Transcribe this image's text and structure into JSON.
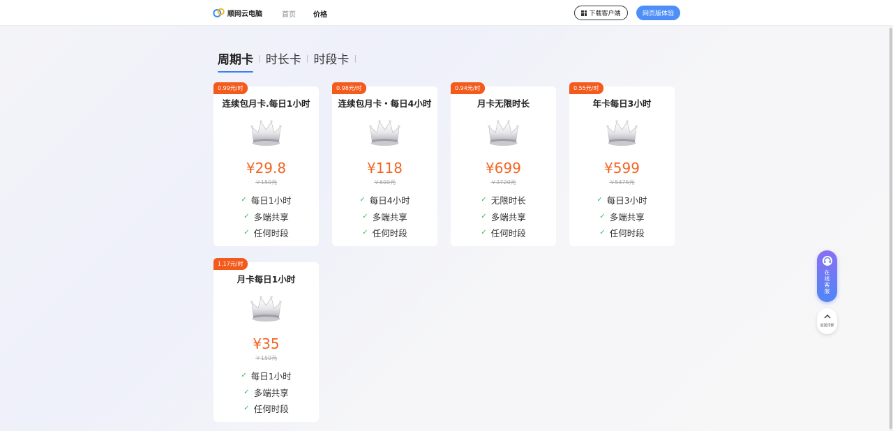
{
  "header": {
    "brand_name": "顺网云电脑",
    "nav": [
      {
        "label": "首页",
        "active": false
      },
      {
        "label": "价格",
        "active": true
      }
    ],
    "download_label": "下载客户端",
    "web_label": "网页版体验",
    "accent_color": "#4e8ef7"
  },
  "tabs": [
    {
      "label": "周期卡",
      "active": true
    },
    {
      "label": "时长卡",
      "active": false
    },
    {
      "label": "时段卡",
      "active": false
    }
  ],
  "plans": [
    {
      "badge": "0.99元/时",
      "title": "连续包月卡.每日1小时",
      "price": "¥29.8",
      "original": "￥150元",
      "features": [
        "每日1小时",
        "多端共享",
        "任何时段"
      ],
      "icon": "crown-icon"
    },
    {
      "badge": "0.98元/时",
      "title": "连续包月卡・每日4小时",
      "price": "¥118",
      "original": "￥600元",
      "features": [
        "每日4小时",
        "多端共享",
        "任何时段"
      ],
      "icon": "crown-icon"
    },
    {
      "badge": "0.94元/时",
      "title": "月卡无限时长",
      "price": "¥699",
      "original": "￥3720元",
      "features": [
        "无限时长",
        "多端共享",
        "任何时段"
      ],
      "icon": "crown-icon"
    },
    {
      "badge": "0.55元/时",
      "title": "年卡每日3小时",
      "price": "¥599",
      "original": "￥5475元",
      "features": [
        "每日3小时",
        "多端共享",
        "任何时段"
      ],
      "icon": "crown-icon"
    },
    {
      "badge": "1.17元/时",
      "title": "月卡每日1小时",
      "price": "¥35",
      "original": "￥150元",
      "features": [
        "每日1小时",
        "多端共享",
        "任何时段"
      ],
      "icon": "crown-icon"
    }
  ],
  "float": {
    "service_label": "在线客服",
    "backtop_label": "返回顶部"
  },
  "colors": {
    "badge": "#f35a1c",
    "price": "#f36422",
    "check": "#30c25b"
  }
}
